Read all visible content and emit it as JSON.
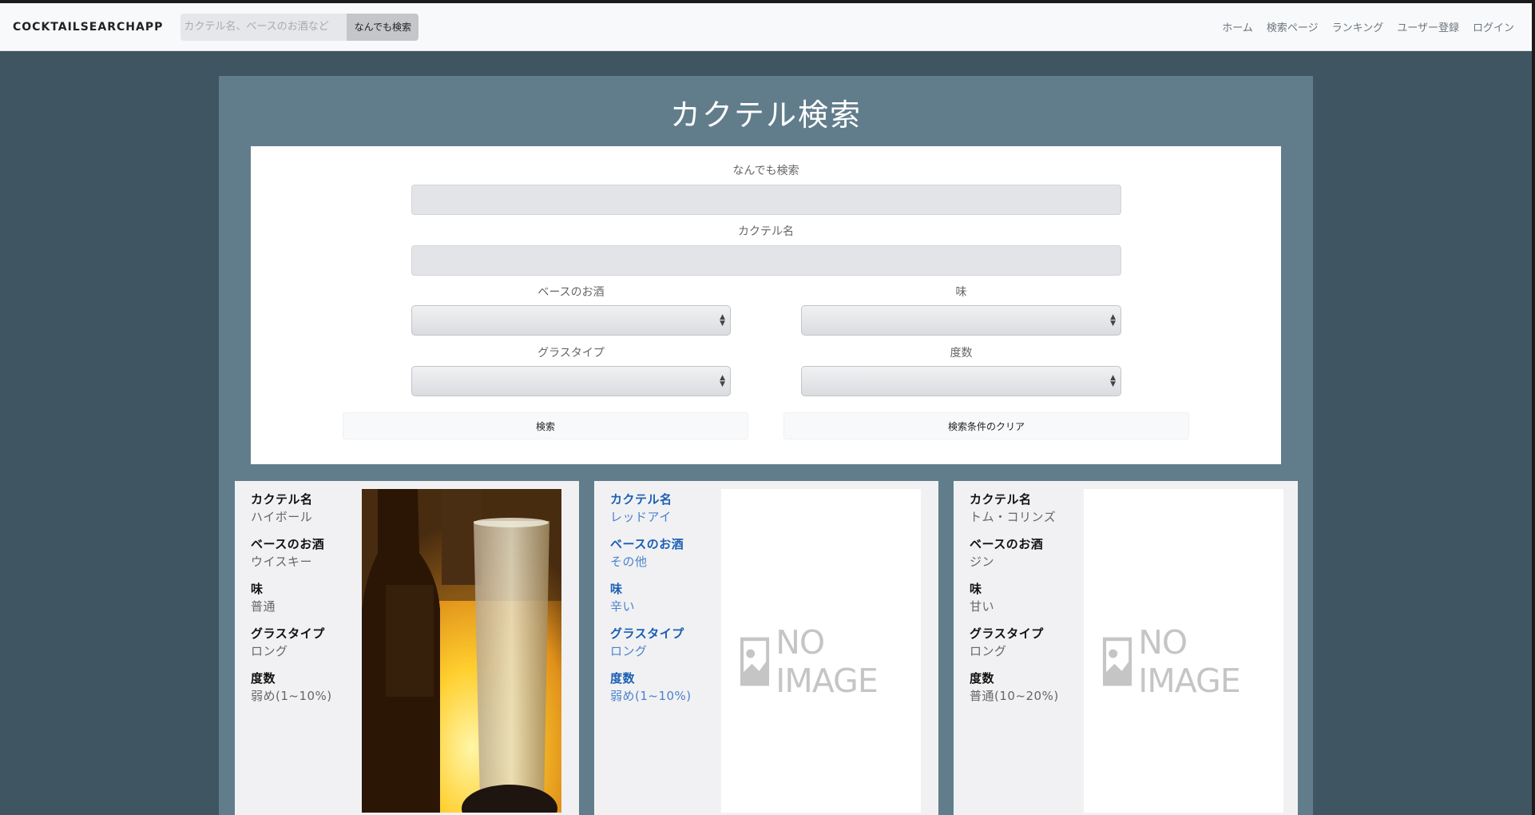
{
  "navbar": {
    "brand": "COCKTAILSEARCHAPP",
    "search_placeholder": "カクテル名、ベースのお酒など",
    "search_button": "なんでも検索",
    "links": [
      "ホーム",
      "検索ページ",
      "ランキング",
      "ユーザー登録",
      "ログイン"
    ]
  },
  "page": {
    "title": "カクテル検索"
  },
  "form": {
    "anything_label": "なんでも検索",
    "anything_value": "",
    "name_label": "カクテル名",
    "name_value": "",
    "base_label": "ベースのお酒",
    "base_value": "",
    "taste_label": "味",
    "taste_value": "",
    "glass_label": "グラスタイプ",
    "glass_value": "",
    "strength_label": "度数",
    "strength_value": "",
    "search_button": "検索",
    "clear_button": "検索条件のクリア"
  },
  "cards": [
    {
      "name_label": "カクテル名",
      "name": "ハイボール",
      "base_label": "ベースのお酒",
      "base": "ウイスキー",
      "taste_label": "味",
      "taste": "普通",
      "glass_label": "グラスタイプ",
      "glass": "ロング",
      "strength_label": "度数",
      "strength": "弱め(1~10%)",
      "image": "photo"
    },
    {
      "name_label": "カクテル名",
      "name": "レッドアイ",
      "base_label": "ベースのお酒",
      "base": "その他",
      "taste_label": "味",
      "taste": "辛い",
      "glass_label": "グラスタイプ",
      "glass": "ロング",
      "strength_label": "度数",
      "strength": "弱め(1~10%)",
      "image": "NO IMAGE"
    },
    {
      "name_label": "カクテル名",
      "name": "トム・コリンズ",
      "base_label": "ベースのお酒",
      "base": "ジン",
      "taste_label": "味",
      "taste": "甘い",
      "glass_label": "グラスタイプ",
      "glass": "ロング",
      "strength_label": "度数",
      "strength": "普通(10~20%)",
      "image": "NO IMAGE"
    }
  ],
  "colors": {
    "background": "#3f5561",
    "panel": "#617d8b",
    "link": "#1a5fb4"
  }
}
